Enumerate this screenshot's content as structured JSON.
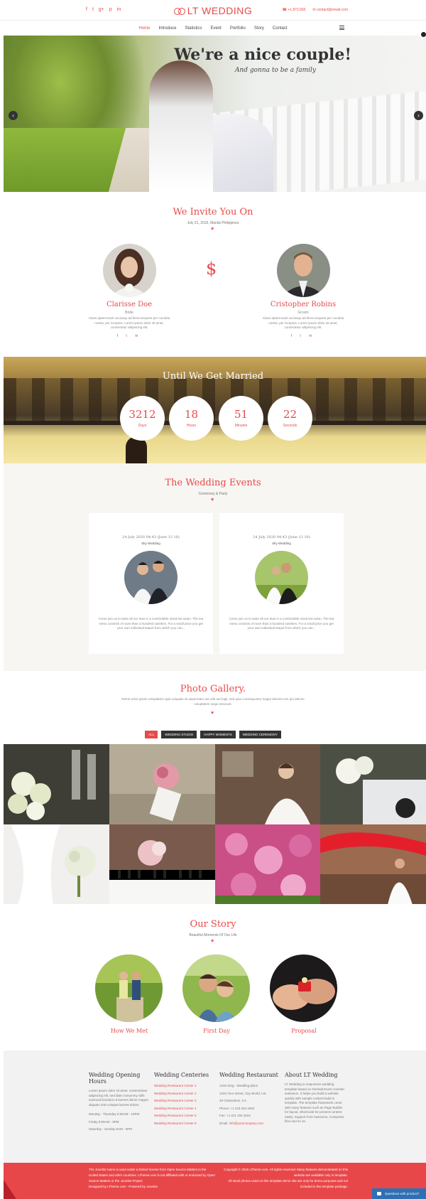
{
  "header": {
    "social_icons": [
      "facebook-icon",
      "twitter-icon",
      "google-plus-icon",
      "pinterest-icon",
      "linkedin-icon"
    ],
    "social_glyphs": [
      "f",
      "t",
      "g+",
      "p",
      "in"
    ],
    "logo_text": "LT WEDDING",
    "phone": "+1.873.666",
    "email": "contact@email.com"
  },
  "nav": {
    "items": [
      "Home",
      "Introduce",
      "Statistics",
      "Event",
      "Portfolio",
      "Story",
      "Contact"
    ],
    "active_index": 0
  },
  "hero": {
    "title": "We're a nice couple!",
    "subtitle": "And gonna to be a family",
    "prev_glyph": "‹",
    "next_glyph": "›"
  },
  "invite": {
    "title": "We Invite You On",
    "date": "July 21, 2015, Manila Philippines",
    "heart": "♥",
    "separator_glyph": "$",
    "bride": {
      "name": "Clarisse Doe",
      "role": "Bride",
      "bio": "Class aptent taciti sociosqu ad litora torquent per conubia nostra, per inceptos. Lorem ipsum dolor sit amet, consectetur adipiscing elit.",
      "social": "f t ✉"
    },
    "groom": {
      "name": "Cristopher Robins",
      "role": "Groom",
      "bio": "Class aptent taciti sociosqu ad litora torquent per conubia nostra, per inceptos. Lorem ipsum dolor sit amet, consectetur adipiscing elit.",
      "social": "f t ✉"
    }
  },
  "countdown": {
    "title": "Until We Get Married",
    "units": [
      {
        "value": "3212",
        "label": "Days"
      },
      {
        "value": "18",
        "label": "Hours"
      },
      {
        "value": "51",
        "label": "Minutes"
      },
      {
        "value": "22",
        "label": "Seconds"
      }
    ]
  },
  "events": {
    "title": "The Wedding Events",
    "subtitle": "Ceremony & Party",
    "heart": "♥",
    "cards": [
      {
        "date": "24 July 2020 04:43 (June 12 16)",
        "type": "Sky Wedding",
        "text": "Come join us to taste all our teas in a comfortable sized tea salon. The tea menu consists of more than a hundred varieties. For a small price you get your own individual teapot from which you can..."
      },
      {
        "date": "24 July 2020 04:43 (June 12 16)",
        "type": "Sky Wedding",
        "text": "Come join us to taste all our teas in a comfortable sized tea salon. The tea menu consists of more than a hundred varieties. For a small price you get your own individual teapot from which you can..."
      }
    ]
  },
  "gallery": {
    "title": "Photo Gallery.",
    "description": "Neme enim ipsam voluptatem quia voluptas sit aspernatur aut odit aut fugit, sed quia consequuntur magni dolores eos qui ratione voluptatem sequi nesciunt.",
    "heart": "♥",
    "filters": [
      "ALL",
      "WEDDING STUDIO",
      "HAPPY MOMENTS",
      "WEDDING CEREMONY"
    ],
    "active_filter": 0
  },
  "story": {
    "title": "Our Story",
    "subtitle": "Beautiful Moments Of Our Life",
    "heart": "♥",
    "items": [
      "How We Met",
      "First Day",
      "Proposal"
    ]
  },
  "footer": {
    "col1": {
      "title": "Wedding Opening Hours",
      "text": "Lorem ipsum dolor sit amet, consectetuer adipiscing elit, sed diam nonummy nibh euismod tincidunt ut laoreet dolore magna aliquam erat volutpat laoreet dolore.",
      "hours": [
        "Monday - Thursday 9:00AM - 10PM",
        "Friday 9:00AM - 9PM",
        "Saturday - Sunday 9AM - 6PM"
      ]
    },
    "col2": {
      "title": "Wedding Centeries",
      "links": [
        "Wedding Restaurant Center 1",
        "Wedding Restaurant Center 2",
        "Wedding Restaurant Center 3",
        "Wedding Restaurant Center 4",
        "Wedding Restaurant Center 5",
        "Wedding Restaurant Center 6"
      ]
    },
    "col3": {
      "title": "Wedding Restaurant",
      "lines": [
        "Aries King - Wedding place",
        "1234 Your Street, City World, US",
        "49 Chameleon, CA",
        "Phone: +1 223 334 3454",
        "Fax: +1 221 334 3222"
      ],
      "email_label": "Email:",
      "email": "info@yourcompany.com"
    },
    "col4": {
      "title": "About LT Wedding",
      "text": "LT Wedding is responsive wedding template based on Onehalt Event Joomla! extension. It helps you build a website quickly with sample content build in template. The template framework come with many features such as Page Builder for layout, Shortcode for present content easily, Support Font Awesome, Compress files and so on."
    }
  },
  "bottom": {
    "left": "The Joomla! name is used under a limited license from Open Source Matters in the United States and other countries. LTheme.com is not affiliated with or endorsed by Open Source Matters or the Joomla! Project.",
    "left_credit": "Designed by LTheme.com - Powered by Joomla!",
    "right": "Copyright © 2015 LTheme.com. All rights reserved. Many features demonstrated on this website are available only in template.",
    "right_note": "All stock photos used on this template demo site are only for demo purposes and not included in the template package.",
    "chat": "Questions with product?"
  },
  "colors": {
    "accent": "#e84a4a",
    "dark": "#333333",
    "footer_bg": "#f2f2f2",
    "bottom_bg": "#e8474a"
  }
}
